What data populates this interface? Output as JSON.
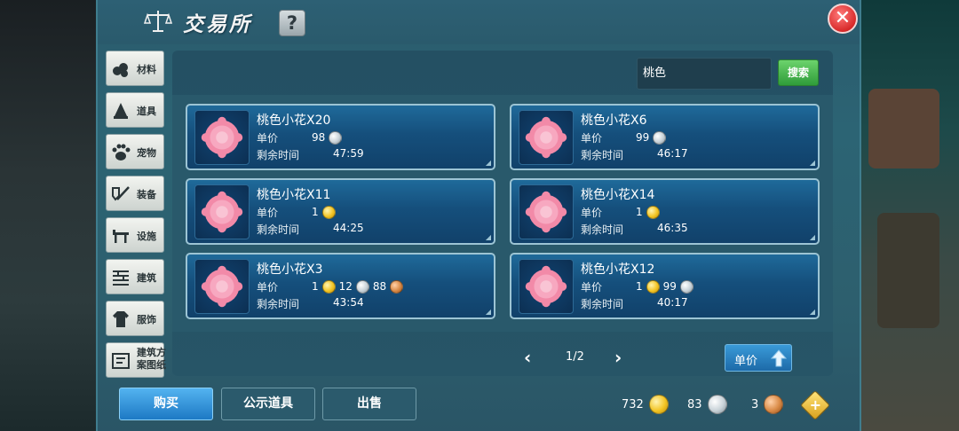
{
  "window": {
    "title": "交易所",
    "help_label": "?",
    "close_label": "✕"
  },
  "sidebar": {
    "items": [
      {
        "label": "材料",
        "icon": "materials-icon"
      },
      {
        "label": "道具",
        "icon": "item-icon"
      },
      {
        "label": "宠物",
        "icon": "pet-paw-icon"
      },
      {
        "label": "装备",
        "icon": "equipment-icon"
      },
      {
        "label": "设施",
        "icon": "facility-icon"
      },
      {
        "label": "建筑",
        "icon": "building-icon"
      },
      {
        "label": "服饰",
        "icon": "clothing-icon"
      },
      {
        "label": "建筑方案图纸",
        "icon": "blueprint-icon"
      }
    ]
  },
  "search": {
    "value": "桃色",
    "button_label": "搜索"
  },
  "listings": {
    "price_label": "单价",
    "time_label": "剩余时间",
    "items": [
      {
        "name": "桃色小花X20",
        "price": [
          {
            "amount": "98",
            "coin": "silver"
          }
        ],
        "time": "47:59"
      },
      {
        "name": "桃色小花X6",
        "price": [
          {
            "amount": "99",
            "coin": "silver"
          }
        ],
        "time": "46:17"
      },
      {
        "name": "桃色小花X11",
        "price": [
          {
            "amount": "1",
            "coin": "gold"
          }
        ],
        "time": "44:25"
      },
      {
        "name": "桃色小花X14",
        "price": [
          {
            "amount": "1",
            "coin": "gold"
          }
        ],
        "time": "46:35"
      },
      {
        "name": "桃色小花X3",
        "price": [
          {
            "amount": "1",
            "coin": "gold"
          },
          {
            "amount": "12",
            "coin": "silver"
          },
          {
            "amount": "88",
            "coin": "copper"
          }
        ],
        "time": "43:54"
      },
      {
        "name": "桃色小花X12",
        "price": [
          {
            "amount": "1",
            "coin": "gold"
          },
          {
            "amount": "99",
            "coin": "silver"
          }
        ],
        "time": "40:17"
      }
    ]
  },
  "pagination": {
    "text": "1/2",
    "prev": "‹",
    "next": "›"
  },
  "sort": {
    "label": "单价"
  },
  "actions": {
    "buy": "购买",
    "public": "公示道具",
    "sell": "出售"
  },
  "wallet": {
    "gold": "732",
    "silver": "83",
    "copper": "3",
    "add_label": "+"
  },
  "colors": {
    "accent": "#2f9c3a",
    "panel": "#2c6474",
    "card": "#154f7c",
    "close": "#d82a2a"
  }
}
